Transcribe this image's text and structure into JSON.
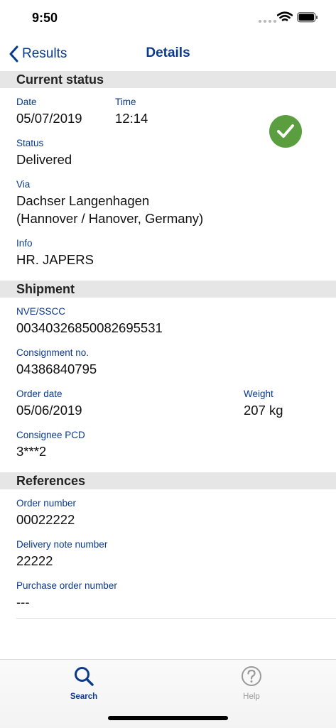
{
  "status_bar": {
    "time": "9:50"
  },
  "nav": {
    "back_label": "Results",
    "title": "Details"
  },
  "current_status": {
    "header": "Current status",
    "date_label": "Date",
    "date_value": "05/07/2019",
    "time_label": "Time",
    "time_value": "12:14",
    "status_label": "Status",
    "status_value": "Delivered",
    "via_label": "Via",
    "via_line1": "Dachser Langenhagen",
    "via_line2": "(Hannover / Hanover, Germany)",
    "info_label": "Info",
    "info_value": "HR. JAPERS",
    "badge_icon": "checkmark-circle-icon",
    "badge_color": "#5b9e3f"
  },
  "shipment": {
    "header": "Shipment",
    "nve_label": "NVE/SSCC",
    "nve_value": "00340326850082695531",
    "consignment_label": "Consignment no.",
    "consignment_value": "04386840795",
    "order_date_label": "Order date",
    "order_date_value": "05/06/2019",
    "weight_label": "Weight",
    "weight_value": "207 kg",
    "pcd_label": "Consignee PCD",
    "pcd_value": "3***2"
  },
  "references": {
    "header": "References",
    "order_number_label": "Order number",
    "order_number_value": "00022222",
    "delivery_note_label": "Delivery note number",
    "delivery_note_value": "22222",
    "purchase_order_label": "Purchase order number",
    "purchase_order_value": "---"
  },
  "tab_bar": {
    "search_label": "Search",
    "search_icon": "search-icon",
    "help_label": "Help",
    "help_icon": "help-icon"
  },
  "colors": {
    "accent": "#0a3a8c",
    "section_bg": "#e6e6e6",
    "inactive_tab": "#9a9a9a"
  }
}
